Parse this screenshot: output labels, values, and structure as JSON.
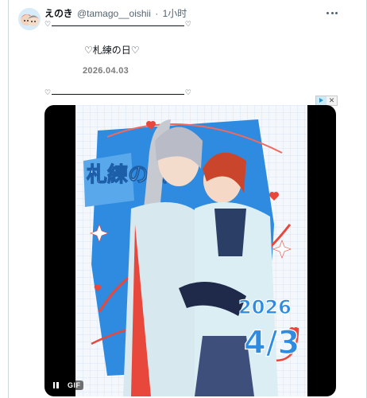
{
  "post": {
    "display_name": "えのき",
    "handle": "@tamago__oishii",
    "separator": "·",
    "time_ago": "1小时",
    "body_line1": "♡札練の日♡",
    "body_line2": "2026.04.03",
    "divider_heart": "♡"
  },
  "media": {
    "type": "GIF",
    "art_title": "札練の日",
    "art_date_year": "2026",
    "art_date_md": "4/3"
  },
  "ad_badge": {
    "close": "✕"
  },
  "colors": {
    "text": "#0f1419",
    "muted": "#536471",
    "media_bg": "#000000",
    "art_blue": "#2f8be0",
    "art_red": "#e8473b"
  },
  "icons": [
    "avatar",
    "more-icon",
    "ad-info-icon",
    "close-icon",
    "pause-icon"
  ]
}
